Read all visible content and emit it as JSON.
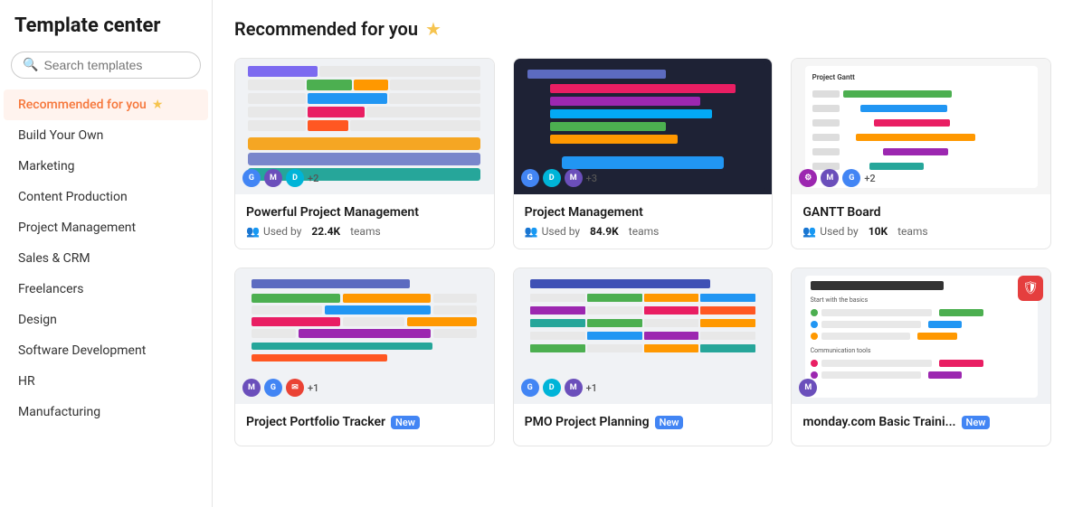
{
  "sidebar": {
    "title": "Template center",
    "search_placeholder": "Search templates",
    "nav_items": [
      {
        "id": "recommended",
        "label": "Recommended for you",
        "active": true,
        "has_star": true
      },
      {
        "id": "build-your-own",
        "label": "Build Your Own",
        "active": false
      },
      {
        "id": "marketing",
        "label": "Marketing",
        "active": false
      },
      {
        "id": "content-production",
        "label": "Content Production",
        "active": false
      },
      {
        "id": "project-management",
        "label": "Project Management",
        "active": false
      },
      {
        "id": "sales-crm",
        "label": "Sales & CRM",
        "active": false
      },
      {
        "id": "freelancers",
        "label": "Freelancers",
        "active": false
      },
      {
        "id": "design",
        "label": "Design",
        "active": false
      },
      {
        "id": "software-development",
        "label": "Software Development",
        "active": false
      },
      {
        "id": "hr",
        "label": "HR",
        "active": false
      },
      {
        "id": "manufacturing",
        "label": "Manufacturing",
        "active": false
      }
    ]
  },
  "main": {
    "section_title": "Recommended for you",
    "templates": [
      {
        "id": "powerful-pm",
        "name": "Powerful Project Management",
        "usage_prefix": "Used by",
        "usage_count": "22.4K",
        "usage_suffix": "teams",
        "badges_count": "+2",
        "is_new": false
      },
      {
        "id": "project-management",
        "name": "Project Management",
        "usage_prefix": "Used by",
        "usage_count": "84.9K",
        "usage_suffix": "teams",
        "badges_count": "+3",
        "is_new": false
      },
      {
        "id": "gantt-board",
        "name": "GANTT Board",
        "usage_prefix": "Used by",
        "usage_count": "10K",
        "usage_suffix": "teams",
        "badges_count": "+2",
        "is_new": false
      },
      {
        "id": "portfolio-tracker",
        "name": "Project Portfolio Tracker",
        "usage_prefix": "",
        "usage_count": "",
        "usage_suffix": "",
        "badges_count": "+1",
        "is_new": true,
        "new_label": "New"
      },
      {
        "id": "pmo-planning",
        "name": "PMO Project Planning",
        "usage_prefix": "",
        "usage_count": "",
        "usage_suffix": "",
        "badges_count": "+1",
        "is_new": true,
        "new_label": "New"
      },
      {
        "id": "basic-training",
        "name": "monday.com Basic Traini...",
        "usage_prefix": "",
        "usage_count": "",
        "usage_suffix": "",
        "badges_count": "",
        "is_new": true,
        "new_label": "New"
      }
    ]
  }
}
